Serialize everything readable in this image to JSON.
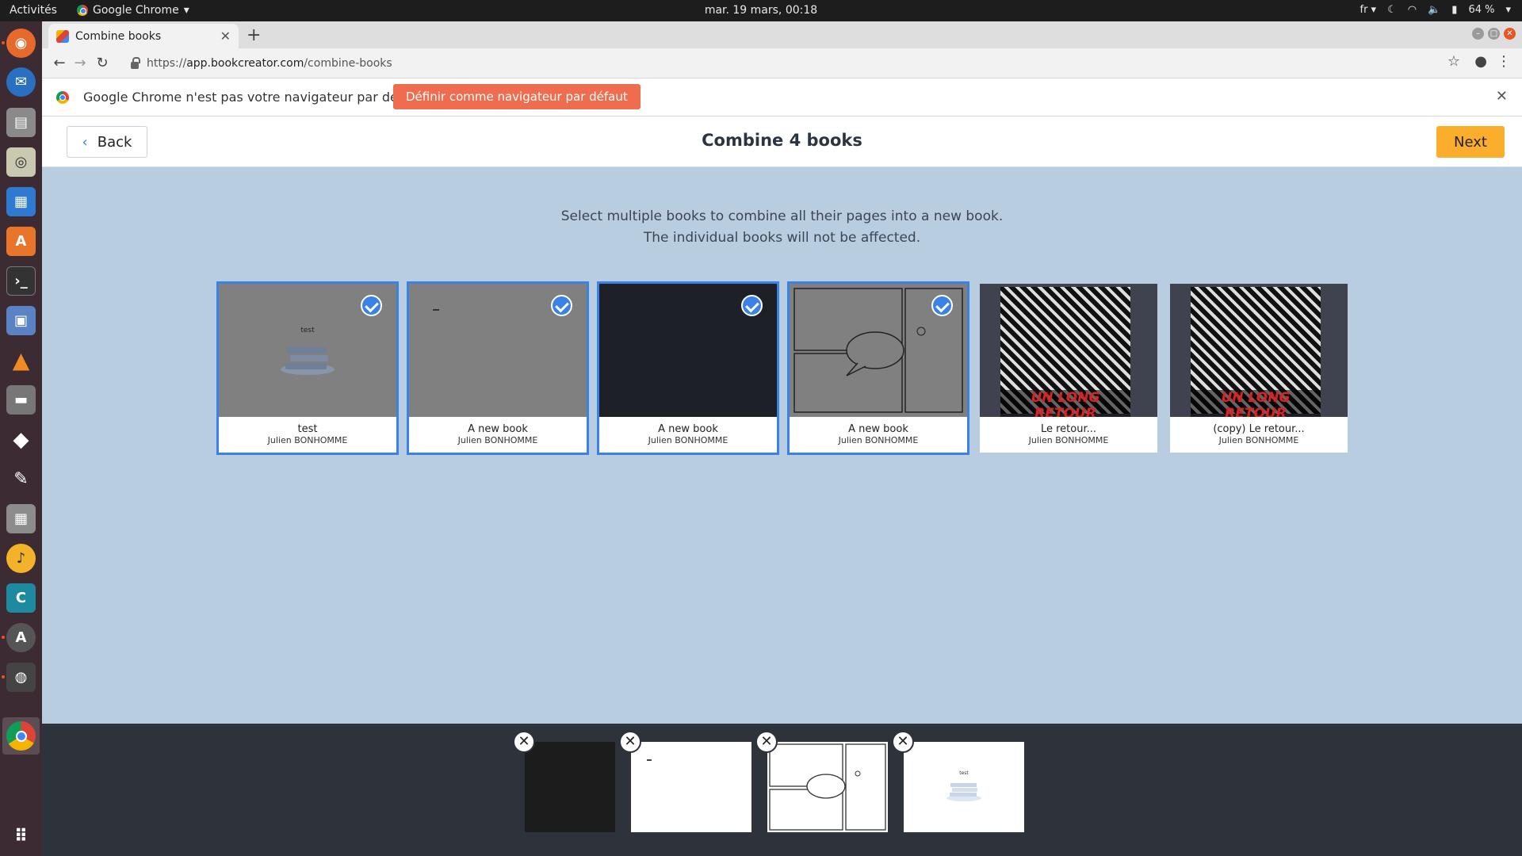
{
  "system": {
    "activities": "Activités",
    "app_name": "Google Chrome",
    "clock": "mar. 19 mars, 00:18",
    "lang": "fr",
    "battery": "64 %"
  },
  "browser": {
    "tab_title": "Combine books",
    "url_scheme": "https://",
    "url_host": "app.bookcreator.com",
    "url_path": "/combine-books"
  },
  "infobar": {
    "message": "Google Chrome n'est pas votre navigateur par défaut",
    "button": "Définir comme navigateur par défaut"
  },
  "header": {
    "back_label": "Back",
    "title": "Combine 4 books",
    "next_label": "Next"
  },
  "instructions": {
    "line1": "Select multiple books to combine all their pages into a new book.",
    "line2": "The individual books will not be affected."
  },
  "books": [
    {
      "title": "test",
      "author": "Julien BONHOMME",
      "selected": true,
      "cover_text": "test"
    },
    {
      "title": "A new book",
      "author": "Julien BONHOMME",
      "selected": true
    },
    {
      "title": "A new book",
      "author": "Julien BONHOMME",
      "selected": true
    },
    {
      "title": "A new book",
      "author": "Julien BONHOMME",
      "selected": true
    },
    {
      "title": "Le retour...",
      "author": "Julien BONHOMME",
      "selected": false,
      "cover_text": "UN LONG RETOUR"
    },
    {
      "title": "(copy) Le retour...",
      "author": "Julien BONHOMME",
      "selected": false,
      "cover_text": "UN LONG RETOUR"
    }
  ],
  "tray": {
    "thumbs": [
      {
        "kind": "dark"
      },
      {
        "kind": "blank"
      },
      {
        "kind": "comic"
      },
      {
        "kind": "test",
        "text": "test"
      }
    ]
  },
  "colors": {
    "accent": "#3b82e6",
    "next": "#fbae2c",
    "infobar_button": "#f06c4e",
    "page_bg": "#b9cde0",
    "tray_bg": "#2e323b"
  }
}
